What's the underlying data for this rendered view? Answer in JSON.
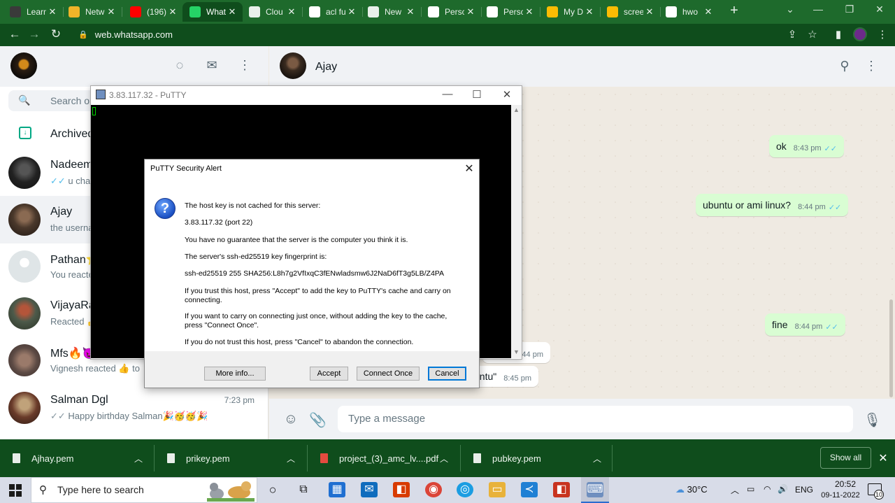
{
  "browser": {
    "tabs": [
      {
        "label": "Learn",
        "icon": "udemy-icon",
        "color": "#3a3a3a"
      },
      {
        "label": "Netw",
        "icon": "package-icon",
        "color": "#f0b429"
      },
      {
        "label": "(196)",
        "icon": "youtube-icon",
        "color": "#ff0000"
      },
      {
        "label": "What",
        "icon": "whatsapp-icon",
        "color": "#25d366"
      },
      {
        "label": "Clou",
        "icon": "globe-icon",
        "color": "#e8f0ea"
      },
      {
        "label": "acl fu",
        "icon": "google-icon",
        "color": "#ffffff"
      },
      {
        "label": "New",
        "icon": "shield-icon",
        "color": "#e8f0ea"
      },
      {
        "label": "Persc",
        "icon": "google-icon",
        "color": "#ffffff"
      },
      {
        "label": "Persc",
        "icon": "google-icon",
        "color": "#ffffff"
      },
      {
        "label": "My D",
        "icon": "drive-icon",
        "color": "#fbbc04"
      },
      {
        "label": "scree",
        "icon": "drive-icon",
        "color": "#fbbc04"
      },
      {
        "label": "hwo",
        "icon": "google-icon",
        "color": "#ffffff"
      }
    ],
    "url": "web.whatsapp.com"
  },
  "whatsapp": {
    "search_placeholder": "Search or",
    "archived_label": "Archived",
    "chats": [
      {
        "name": "Nadeem",
        "preview": "u chan",
        "time": "",
        "ticks": "✓✓"
      },
      {
        "name": "Ajay",
        "preview": "the userna",
        "time": "",
        "ticks": ""
      },
      {
        "name": "Pathan⭐",
        "preview": "You reacte",
        "time": "",
        "ticks": ""
      },
      {
        "name": "VijayaRa",
        "preview": "Reacted 👍",
        "time": "",
        "ticks": ""
      },
      {
        "name": "Mfs🔥😈",
        "preview": "Vignesh reacted 👍 to",
        "time": "",
        "ticks": ""
      },
      {
        "name": "Salman Dgl",
        "preview": "Happy birthday Salman🎉🥳🥳🎉",
        "time": "7:23 pm",
        "ticks": "✓✓"
      }
    ],
    "contact_name": "Ajay",
    "messages": [
      {
        "text": "ok",
        "time": "8:43 pm",
        "ticks": "✓✓",
        "out": true
      },
      {
        "text": "ubuntu or ami linux?",
        "time": "8:44 pm",
        "ticks": "✓✓",
        "out": true
      },
      {
        "text": "fine",
        "time": "8:44 pm",
        "ticks": "✓✓",
        "out": true
      },
      {
        "text": "",
        "time": "8:44 pm",
        "ticks": "",
        "out": false
      },
      {
        "text": "buntu\"",
        "time": "8:45 pm",
        "ticks": "",
        "out": false
      }
    ],
    "message_placeholder": "Type a message"
  },
  "putty": {
    "window_title": "3.83.117.32 - PuTTY",
    "alert": {
      "title": "PuTTY Security Alert",
      "lines": [
        "The host key is not cached for this server:",
        "3.83.117.32 (port 22)",
        "You have no guarantee that the server is the computer you think it is.",
        "The server's ssh-ed25519 key fingerprint is:",
        "ssh-ed25519 255 SHA256:L8h7g2VfIxqC3fENwladsmw6J2NaD6fT3g5LB/Z4PA",
        "If you trust this host, press \"Accept\" to add the key to PuTTY's cache and carry on connecting.",
        "If you want to carry on connecting just once, without adding the key to the cache, press \"Connect Once\".",
        "If you do not trust this host, press \"Cancel\" to abandon the connection."
      ],
      "buttons": {
        "more_info": "More info...",
        "accept": "Accept",
        "connect_once": "Connect Once",
        "cancel": "Cancel"
      }
    }
  },
  "downloads": {
    "items": [
      {
        "name": "Ajhay.pem",
        "type": "file"
      },
      {
        "name": "prikey.pem",
        "type": "file"
      },
      {
        "name": "project_(3)_amc_lv....pdf",
        "type": "pdf"
      },
      {
        "name": "pubkey.pem",
        "type": "file"
      }
    ],
    "show_all": "Show all"
  },
  "taskbar": {
    "search_placeholder": "Type here to search",
    "weather": "30°C",
    "language": "ENG",
    "time": "20:52",
    "date": "09-11-2022",
    "notification_count": "10"
  }
}
